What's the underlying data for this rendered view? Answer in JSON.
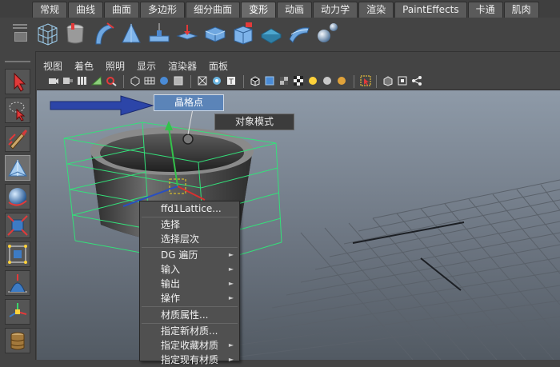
{
  "shelf": {
    "tabs": [
      {
        "label": "常规",
        "active": false
      },
      {
        "label": "曲线",
        "active": false
      },
      {
        "label": "曲面",
        "active": false
      },
      {
        "label": "多边形",
        "active": false
      },
      {
        "label": "细分曲面",
        "active": false
      },
      {
        "label": "变形",
        "active": true
      },
      {
        "label": "动画",
        "active": false
      },
      {
        "label": "动力学",
        "active": false
      },
      {
        "label": "渲染",
        "active": false
      },
      {
        "label": "PaintEffects",
        "active": false
      },
      {
        "label": "卡通",
        "active": false
      },
      {
        "label": "肌肉",
        "active": false
      }
    ],
    "icons": [
      "lattice-deformer-icon",
      "cluster-deformer-icon",
      "bend-deformer-icon",
      "sculpt-deformer-icon",
      "wave-deformer-icon",
      "twist-deformer-icon",
      "flare-deformer-icon",
      "squash-deformer-icon",
      "sine-deformer-icon",
      "wrap-deformer-icon",
      "wire-deformer-icon",
      "jiggle-deformer-icon"
    ]
  },
  "toolbox": {
    "tools": [
      "select-tool-icon",
      "lasso-tool-icon",
      "paint-select-tool-icon",
      "move-tool-icon",
      "rotate-tool-icon",
      "scale-tool-icon",
      "universal-manipulator-icon",
      "soft-modify-tool-icon",
      "show-manipulator-icon",
      "last-tool-icon"
    ]
  },
  "panel": {
    "menu": [
      "视图",
      "着色",
      "照明",
      "显示",
      "渲染器",
      "面板"
    ]
  },
  "viewport": {
    "lattice_label": "晶格点",
    "object_mode_label": "对象模式"
  },
  "context_menu": {
    "title": "ffd1Lattice...",
    "items": [
      {
        "label": "选择",
        "submenu": false
      },
      {
        "label": "选择层次",
        "submenu": false
      },
      {
        "label": "DG 遍历",
        "submenu": true
      },
      {
        "label": "输入",
        "submenu": true
      },
      {
        "label": "输出",
        "submenu": true
      },
      {
        "label": "操作",
        "submenu": true
      },
      {
        "label": "材质属性...",
        "submenu": false
      },
      {
        "label": "指定新材质...",
        "submenu": false
      },
      {
        "label": "指定收藏材质",
        "submenu": true
      },
      {
        "label": "指定现有材质",
        "submenu": true
      }
    ]
  },
  "colors": {
    "active_tab": "#6b6b6b",
    "lattice_wire": "#34e07a",
    "highlight_blue": "#5b84b8",
    "viewport_top": "#8e9aa8"
  }
}
